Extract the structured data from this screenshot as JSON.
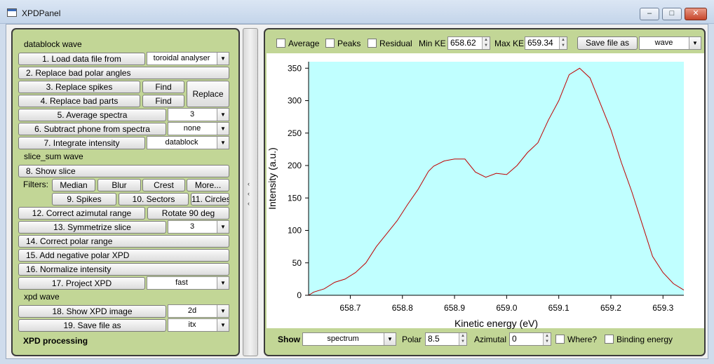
{
  "window": {
    "title": "XPDPanel"
  },
  "left": {
    "datablock_header": "datablock wave",
    "load_label": "1. Load data file from",
    "load_source": "toroidal analyser",
    "replace_polar_label": "2. Replace bad polar angles",
    "replace_spikes_label": "3. Replace spikes",
    "find1_label": "Find",
    "replace_bad_parts_label": "4. Replace bad parts",
    "find2_label": "Find",
    "replace_label": "Replace",
    "average_label": "5. Average spectra",
    "average_value": "3",
    "subtract_label": "6. Subtract phone from spectra",
    "subtract_value": "none",
    "integrate_label": "7. Integrate intensity",
    "integrate_value": "datablock",
    "slice_header": "slice_sum wave",
    "show_slice_label": "8. Show slice",
    "filters_label": "Filters:",
    "median_label": "Median",
    "blur_label": "Blur",
    "crest_label": "Crest",
    "more_label": "More...",
    "spikes_label": "9. Spikes",
    "sectors_label": "10. Sectors",
    "circles_label": "11. Circles",
    "correct_az_label": "12. Correct azimutal range",
    "rotate_label": "Rotate 90 deg",
    "symmetrize_label": "13. Symmetrize slice",
    "symmetrize_value": "3",
    "correct_polar_label": "14. Correct polar range",
    "add_negative_label": "15. Add negative polar XPD",
    "normalize_label": "16. Normalize intensity",
    "project_label": "17. Project XPD",
    "project_value": "fast",
    "xpd_header": "xpd wave",
    "show_xpd_label": "18. Show XPD image",
    "show_xpd_value": "2d",
    "save_file_label": "19. Save file as",
    "save_file_value": "itx",
    "footer": "XPD processing"
  },
  "top": {
    "average_label": "Average",
    "peaks_label": "Peaks",
    "residual_label": "Residual",
    "min_ke_label": "Min KE",
    "min_ke_value": "658.62",
    "max_ke_label": "Max KE",
    "max_ke_value": "659.34",
    "save_as_label": "Save file as",
    "save_as_value": "wave"
  },
  "bottom": {
    "show_label": "Show",
    "show_value": "spectrum",
    "polar_label": "Polar",
    "polar_value": "8.5",
    "azimutal_label": "Azimutal",
    "azimutal_value": "0",
    "where_label": "Where?",
    "binding_label": "Binding energy"
  },
  "colors": {
    "panel_bg": "#c2d696",
    "plot_bg": "#c0ffff",
    "trace": "#c00000"
  },
  "chart_data": {
    "type": "line",
    "xlabel": "Kinetic energy (eV)",
    "ylabel": "Intensity (a.u.)",
    "xlim": [
      658.62,
      659.34
    ],
    "ylim": [
      0,
      360
    ],
    "xticks": [
      658.7,
      658.8,
      658.9,
      659.0,
      659.1,
      659.2,
      659.3
    ],
    "yticks": [
      0,
      50,
      100,
      150,
      200,
      250,
      300,
      350
    ],
    "grid": false,
    "x": [
      658.62,
      658.63,
      658.65,
      658.67,
      658.69,
      658.71,
      658.73,
      658.75,
      658.77,
      658.79,
      658.81,
      658.83,
      658.85,
      658.86,
      658.88,
      658.9,
      658.92,
      658.94,
      658.96,
      658.98,
      659.0,
      659.02,
      659.04,
      659.06,
      659.08,
      659.1,
      659.12,
      659.14,
      659.16,
      659.18,
      659.2,
      659.22,
      659.24,
      659.26,
      659.28,
      659.3,
      659.32,
      659.34
    ],
    "y": [
      0,
      5,
      10,
      20,
      25,
      35,
      50,
      75,
      95,
      115,
      140,
      163,
      191,
      199,
      207,
      210,
      210,
      190,
      182,
      188,
      186,
      200,
      220,
      235,
      270,
      300,
      340,
      350,
      335,
      295,
      255,
      205,
      160,
      110,
      60,
      35,
      18,
      8
    ]
  }
}
